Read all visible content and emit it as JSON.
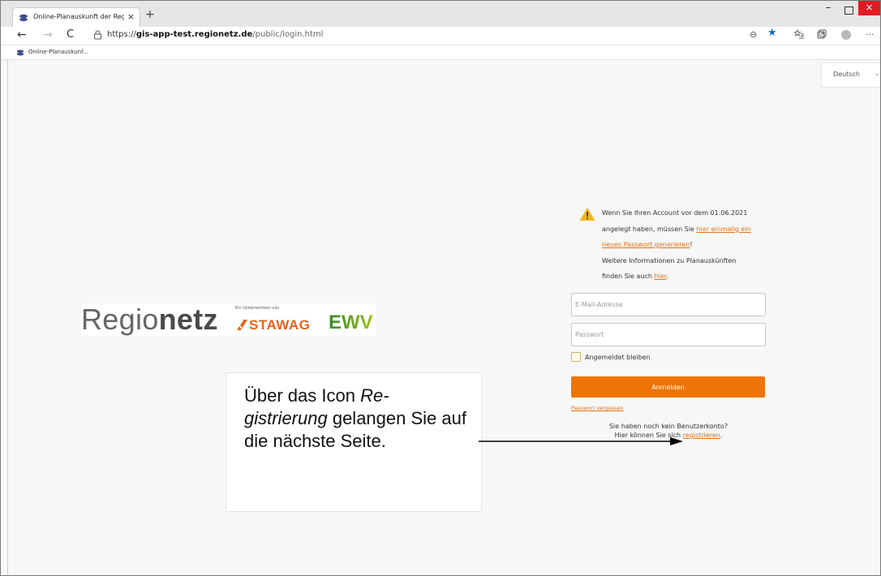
{
  "browser": {
    "tab_title": "Online-Planauskunft der Regionetz",
    "tab_close": "×",
    "new_tab": "+",
    "url_scheme": "https://",
    "url_host": "gis-app-test.regionetz.de",
    "url_path": "/public/login.html",
    "bookmark_label": "Online-Planauskunf...",
    "icons": {
      "back": "←",
      "forward": "→",
      "reload": "C",
      "zoom": "⊖",
      "star": "★",
      "favorites": "⭐",
      "collections": "⊕",
      "more": "···",
      "minimize": "–",
      "close": "×"
    }
  },
  "page": {
    "language": "Deutsch",
    "language_chevron": "⌄",
    "logo": {
      "brand_light": "Regio",
      "brand_bold": "netz",
      "affiliation": "Ein Unternehmen von",
      "stawag": "STAWAG",
      "ewv": "EWV"
    },
    "notice": {
      "line1": "Wenn Sie Ihren Account vor dem 01.06.2021",
      "line2_prefix": "angelegt haben, müssen Sie ",
      "line2_link": "hier einmalig ein",
      "line3_link": "neues Passwort generieren",
      "line3_suffix": "!",
      "line4": "Weitere Informationen zu Planauskünften",
      "line5_prefix": "finden Sie auch ",
      "line5_link": "hier",
      "line5_suffix": "."
    },
    "email_placeholder": "E-Mail-Adresse",
    "password_placeholder": "Passwort",
    "remember_label": "Angemeldet bleiben",
    "login_button": "Anmelden",
    "forgot_password": "Passwort vergessen",
    "no_account_line": "Sie haben noch kein Benutzerkonto?",
    "register_prefix": "Hier können Sie sich ",
    "register_link": "registrieren",
    "register_suffix": "."
  },
  "annotation": {
    "text_1": "Über das Icon  ",
    "text_italic": "Re-gistrierung",
    "text_2": " gelangen Sie auf die nächste Seite."
  },
  "colors": {
    "accent": "#ee7406",
    "link": "#e8700d",
    "ewv_green_dark": "#3a8b2e",
    "ewv_green_light": "#9cc31a",
    "close_red": "#e21b23"
  }
}
